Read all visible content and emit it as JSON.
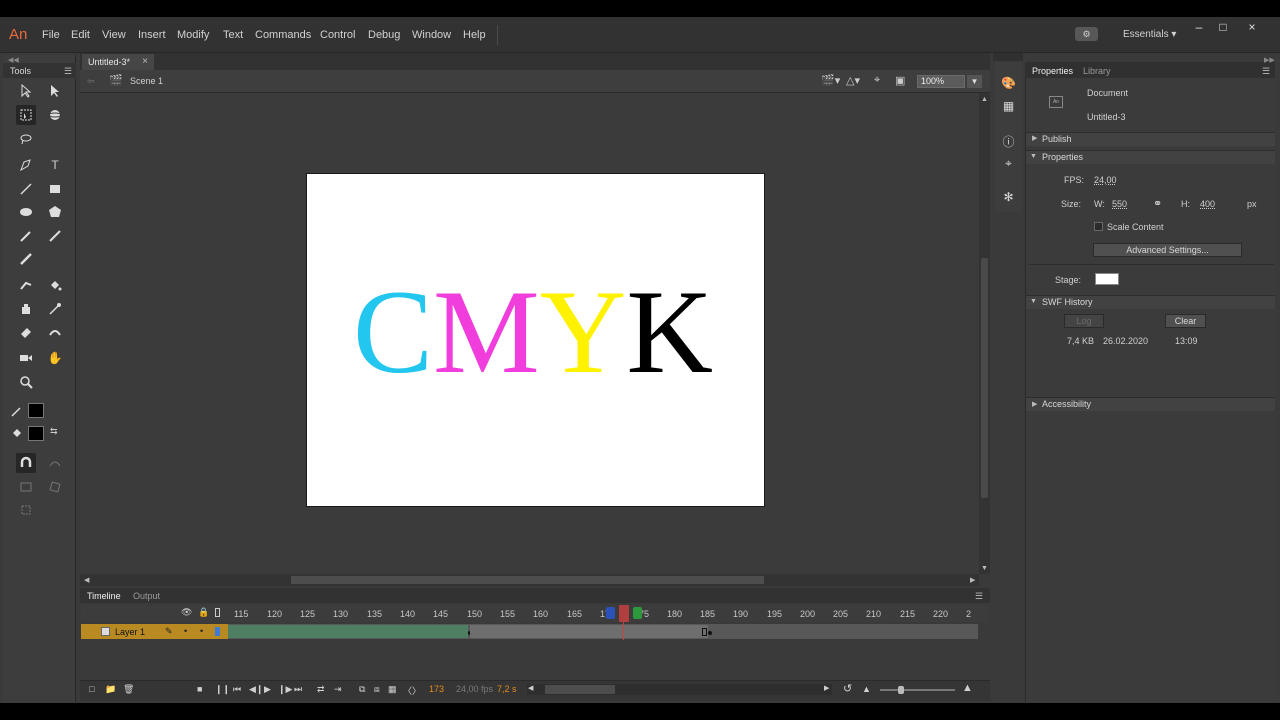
{
  "app": {
    "logo": "An",
    "menu": [
      "File",
      "Edit",
      "View",
      "Insert",
      "Modify",
      "Text",
      "Commands",
      "Control",
      "Debug",
      "Window",
      "Help"
    ],
    "workspace": "Essentials",
    "window_controls": [
      "–",
      "□",
      "×"
    ]
  },
  "tools": {
    "title": "Tools"
  },
  "document": {
    "tab": "Untitled-3*",
    "tab_close": "×",
    "scene": "Scene 1",
    "zoom": "100%",
    "stage_text": [
      {
        "char": "C",
        "color": "#22c6ef"
      },
      {
        "char": "M",
        "color": "#f03ddc"
      },
      {
        "char": "Y",
        "color": "#fff200"
      },
      {
        "char": "K",
        "color": "#000000"
      }
    ]
  },
  "timeline": {
    "tabs": [
      "Timeline",
      "Output"
    ],
    "frame_numbers": [
      "115",
      "120",
      "125",
      "130",
      "135",
      "140",
      "145",
      "150",
      "155",
      "160",
      "165",
      "170",
      "175",
      "180",
      "185",
      "190",
      "195",
      "200",
      "205",
      "210",
      "215",
      "220",
      "2"
    ],
    "layer_name": "Layer 1",
    "current_frame": "173",
    "fps": "24,00 fps",
    "elapsed": "7,2 s"
  },
  "properties": {
    "tabs": [
      "Properties",
      "Library"
    ],
    "doc_type": "Document",
    "doc_name": "Untitled-3",
    "publish_label": "Publish",
    "properties_label": "Properties",
    "fps_label": "FPS:",
    "fps_value": "24,00",
    "size_label": "Size:",
    "w_label": "W:",
    "w_value": "550",
    "h_label": "H:",
    "h_value": "400",
    "unit": "px",
    "scale_content": "Scale Content",
    "advanced_settings": "Advanced Settings...",
    "stage_label": "Stage:",
    "stage_color": "#ffffff",
    "swf_history_label": "SWF History",
    "log_button": "Log",
    "clear_button": "Clear",
    "history": {
      "size": "7,4 KB",
      "date": "26.02.2020",
      "time": "13:09"
    },
    "accessibility_label": "Accessibility"
  }
}
